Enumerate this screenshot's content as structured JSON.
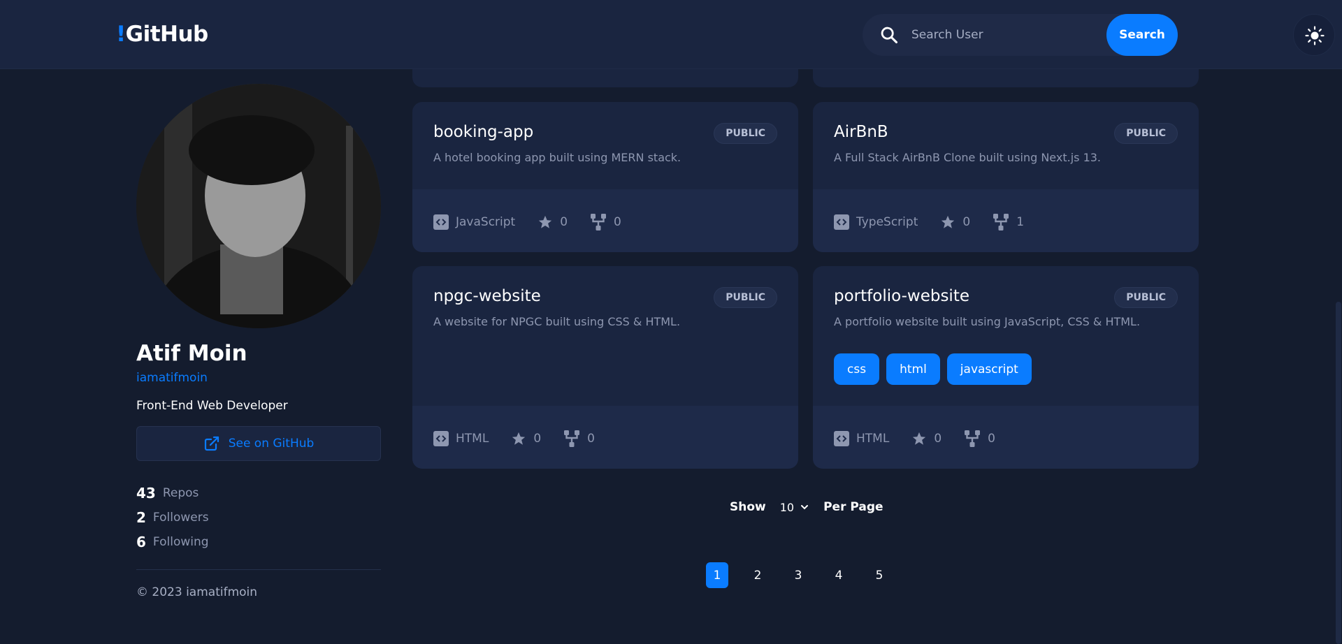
{
  "header": {
    "logo_bang": "!",
    "logo_text": "GitHub",
    "search_placeholder": "Search User",
    "search_button": "Search"
  },
  "profile": {
    "name": "Atif Moin",
    "login": "iamatifmoin",
    "bio": "Front-End Web Developer",
    "github_link": "See on GitHub",
    "stats": [
      {
        "value": "43",
        "label": "Repos"
      },
      {
        "value": "2",
        "label": "Followers"
      },
      {
        "value": "6",
        "label": "Following"
      }
    ],
    "copyright": "© 2023 iamatifmoin"
  },
  "repos": [
    {
      "name": "booking-app",
      "visibility": "PUBLIC",
      "description": "A hotel booking app built using MERN stack.",
      "language": "JavaScript",
      "stars": "0",
      "forks": "0",
      "topics": []
    },
    {
      "name": "AirBnB",
      "visibility": "PUBLIC",
      "description": "A Full Stack AirBnB Clone built using Next.js 13.",
      "language": "TypeScript",
      "stars": "0",
      "forks": "1",
      "topics": []
    },
    {
      "name": "npgc-website",
      "visibility": "PUBLIC",
      "description": "A website for NPGC built using CSS & HTML.",
      "language": "HTML",
      "stars": "0",
      "forks": "0",
      "topics": []
    },
    {
      "name": "portfolio-website",
      "visibility": "PUBLIC",
      "description": "A portfolio website built using JavaScript, CSS & HTML.",
      "language": "HTML",
      "stars": "0",
      "forks": "0",
      "topics": [
        "css",
        "html",
        "javascript"
      ]
    }
  ],
  "pagination": {
    "show_label": "Show",
    "per_page_value": "10",
    "per_page_label": "Per Page",
    "pages": [
      "1",
      "2",
      "3",
      "4",
      "5"
    ],
    "current_page": "1"
  },
  "colors": {
    "accent": "#0a7cff",
    "background": "#141c2e",
    "card": "#1a2540"
  }
}
